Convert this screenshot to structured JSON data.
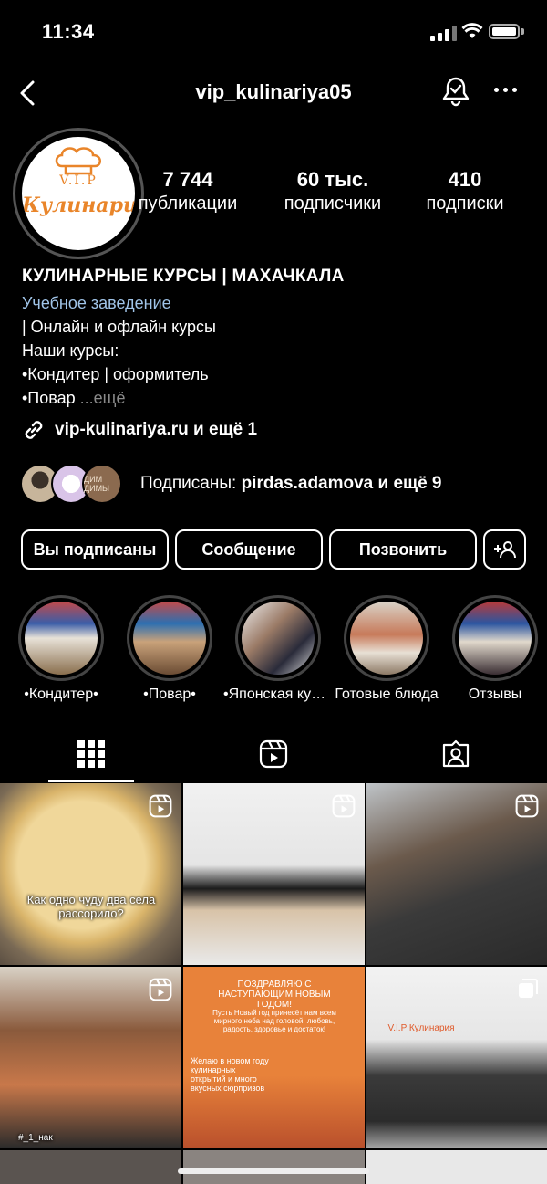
{
  "status_bar": {
    "time": "11:34"
  },
  "header": {
    "username": "vip_kulinariya05"
  },
  "avatar": {
    "vip": "V.I.P",
    "brand": "Кулинария"
  },
  "stats": [
    {
      "value": "7 744",
      "label": "публикации"
    },
    {
      "value": "60 тыс.",
      "label": "подписчики"
    },
    {
      "value": "410",
      "label": "подписки"
    }
  ],
  "bio": {
    "title": "КУЛИНАРНЫЕ КУРСЫ | МАХАЧКАЛА",
    "category": "Учебное заведение",
    "line1": "| Онлайн и офлайн курсы",
    "line2": "Наши курсы:",
    "line3": "•Кондитер | оформитель",
    "line4": "•Повар",
    "more": "...ещё"
  },
  "link": {
    "text": "vip-kulinariya.ru и ещё 1"
  },
  "followed_by": {
    "prefix": "Подписаны: ",
    "user": "pirdas.adamova",
    "suffix": " и ещё 9",
    "avatar3_text": "ДИМ ДИМЫ"
  },
  "actions": {
    "following": "Вы подписаны",
    "message": "Сообщение",
    "call": "Позвонить"
  },
  "highlights": [
    {
      "label": "•Кондитер•"
    },
    {
      "label": "•Повар•"
    },
    {
      "label": "•Японская кухня•"
    },
    {
      "label": "Готовые блюда"
    },
    {
      "label": "Отзывы"
    }
  ],
  "posts": {
    "p1_caption": "Как одно чуду два села рассорило?",
    "p5_title": "ПОЗДРАВЛЯЮ С НАСТУПАЮЩИМ НОВЫМ ГОДОМ!",
    "p5_sub": "Пусть Новый год принесёт нам всем мирного неба над головой, любовь, радость, здоровье и достаток!",
    "p5_wish": "Желаю в новом году кулинарных открытий и много вкусных сюрпризов",
    "p4_tag": "#_1_нак",
    "p6_brand": "V.I.P Кулинария"
  },
  "colors": {
    "bg": "#000000",
    "link": "#a0c4e8",
    "muted": "#8a8a8a"
  }
}
